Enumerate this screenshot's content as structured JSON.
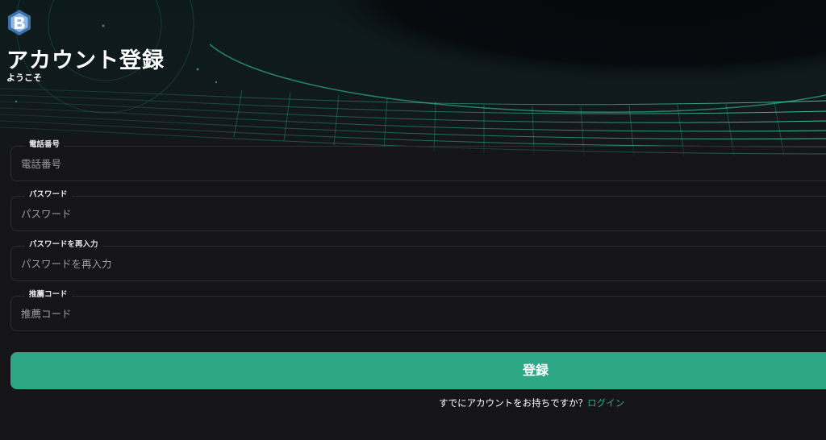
{
  "header": {
    "logo_icon": "b-hexagon-logo-icon",
    "title": "アカウント登録",
    "subtitle": "ようこそ"
  },
  "form": {
    "fields": [
      {
        "label": "電話番号",
        "placeholder": "電話番号",
        "value": ""
      },
      {
        "label": "パスワード",
        "placeholder": "パスワード",
        "value": ""
      },
      {
        "label": "パスワードを再入力",
        "placeholder": "パスワードを再入力",
        "value": ""
      },
      {
        "label": "推薦コード",
        "placeholder": "推薦コード",
        "value": ""
      }
    ],
    "submit_label": "登録"
  },
  "footer": {
    "question": "すでにアカウントをお持ちですか？",
    "login_link": "ログイン"
  },
  "colors": {
    "accent": "#2ea787",
    "background": "#151518",
    "field_border": "#2c2c31",
    "glow": "#36d8a8"
  }
}
